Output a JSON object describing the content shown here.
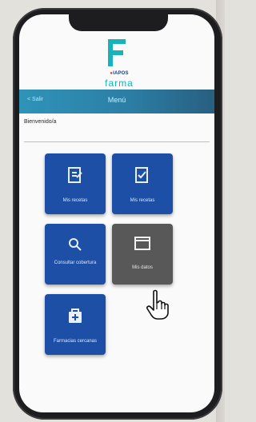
{
  "app": {
    "brand": "IAPOS",
    "name": "farma"
  },
  "topbar": {
    "back_label": "< Salir",
    "title": "Menú"
  },
  "welcome_text": "Bienvenido/a",
  "tiles": [
    {
      "label": "Mis recetas",
      "icon": "prescription-icon",
      "color": "#1e4fa6"
    },
    {
      "label": "Mis recetas",
      "icon": "checklist-icon",
      "color": "#1e4fa6"
    },
    {
      "label": "Consultar cobertura",
      "icon": "search-document-icon",
      "color": "#1e4fa6"
    },
    {
      "label": "Mis datos",
      "icon": "window-icon",
      "color": "#585858"
    },
    {
      "label": "Farmacias cercanas",
      "icon": "pharmacy-bag-icon",
      "color": "#1e4fa6"
    }
  ],
  "colors": {
    "primary": "#1e4fa6",
    "accent": "#18b2b8",
    "header_gradient": [
      "#2f93b8",
      "#285f80"
    ]
  }
}
